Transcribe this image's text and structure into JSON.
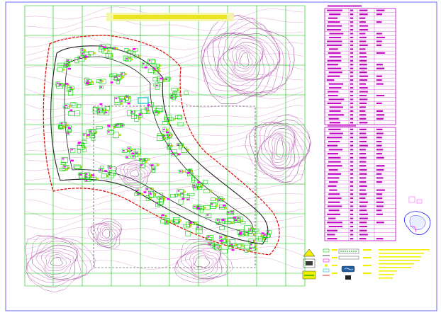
{
  "drawing": {
    "title": "",
    "scale_text": "",
    "colors": {
      "background": "#ffffff",
      "grid": "#00c800",
      "contour": "#c060b8",
      "contour_dark": "#7a2e7a",
      "boundary_red": "#e00000",
      "road_black": "#222222",
      "building_green": "#00d000",
      "building_magenta": "#ff00ff",
      "tree_yellow": "#f5e800",
      "table_frame": "#c000c0",
      "legend_yellow": "#f0f000",
      "cyan": "#00c8c8"
    },
    "icons": [
      "north-arrow-icon",
      "location-map-icon",
      "legend-swatch-icon"
    ]
  },
  "table1": {
    "header": [
      "",
      "",
      "",
      ""
    ],
    "rows": 30
  },
  "table2": {
    "header": [
      "",
      "",
      "",
      ""
    ],
    "rows": 28
  },
  "legend": {
    "items": [
      "",
      "",
      "",
      "",
      "",
      "",
      "",
      ""
    ],
    "notes": [
      "",
      "",
      "",
      "",
      "",
      "",
      ""
    ]
  }
}
